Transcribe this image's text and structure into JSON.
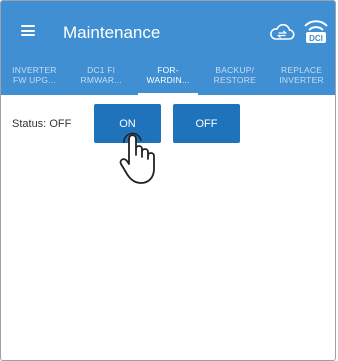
{
  "app": {
    "title": "Maintenance"
  },
  "icons": {
    "menu": "hamburger-menu-icon",
    "cloud": "cloud-sync-icon",
    "dci": "dci-wifi-icon",
    "dci_text": "DCI"
  },
  "tabs": [
    {
      "line1": "INVERTER",
      "line2": "FW UPG...",
      "active": false
    },
    {
      "line1": "DC1 FI",
      "line2": "RMWAR...",
      "active": false
    },
    {
      "line1": "FOR-",
      "line2": "WARDIN...",
      "active": true
    },
    {
      "line1": "BACKUP/",
      "line2": "RESTORE",
      "active": false
    },
    {
      "line1": "REPLACE",
      "line2": "INVERTER",
      "active": false
    }
  ],
  "status": {
    "label": "Status:",
    "value": "OFF"
  },
  "buttons": {
    "on_label": "ON",
    "off_label": "OFF"
  },
  "colors": {
    "primary": "#3f8fd2",
    "button": "#1f73bb",
    "tab_inactive": "#c7ddf1"
  }
}
